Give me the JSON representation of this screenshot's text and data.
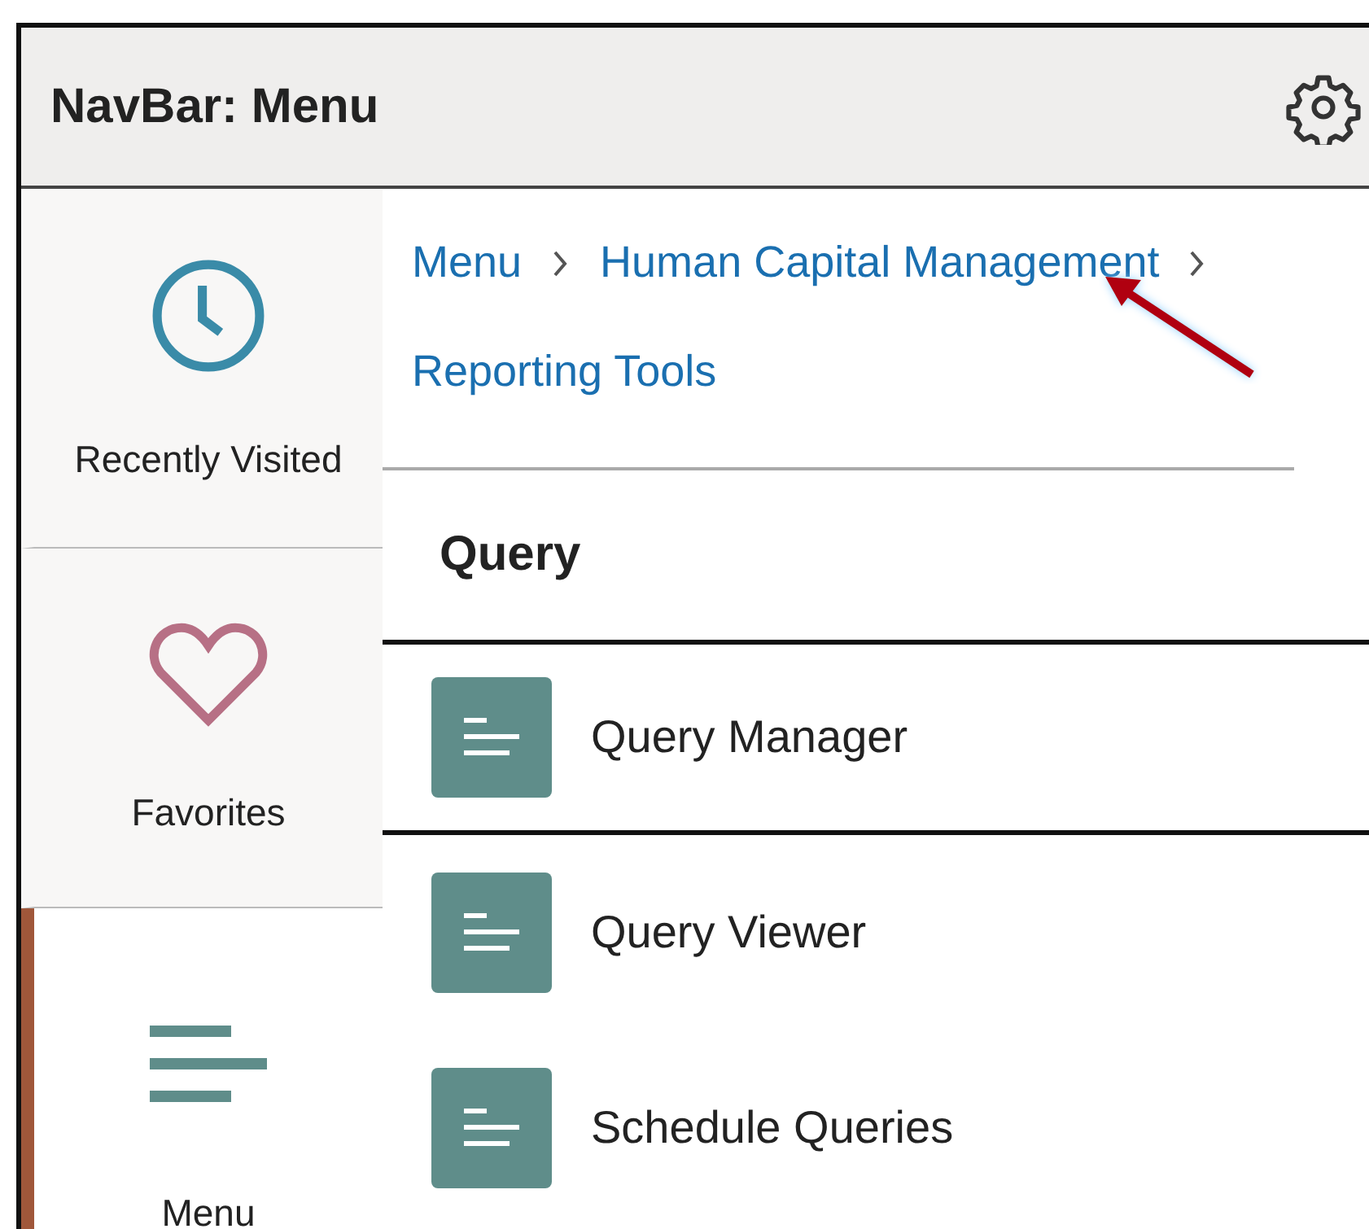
{
  "header": {
    "title": "NavBar: Menu"
  },
  "sidebar": {
    "items": [
      {
        "label": "Recently Visited",
        "kind": "clock",
        "selected": false
      },
      {
        "label": "Favorites",
        "kind": "heart",
        "selected": false
      },
      {
        "label": "Menu",
        "kind": "menu",
        "selected": true
      }
    ]
  },
  "breadcrumb": [
    "Menu",
    "Human Capital Management",
    "Reporting Tools"
  ],
  "section": {
    "title": "Query"
  },
  "items": [
    {
      "label": "Query Manager",
      "selected": true
    },
    {
      "label": "Query Viewer",
      "selected": false
    },
    {
      "label": "Schedule Queries",
      "selected": false
    }
  ]
}
